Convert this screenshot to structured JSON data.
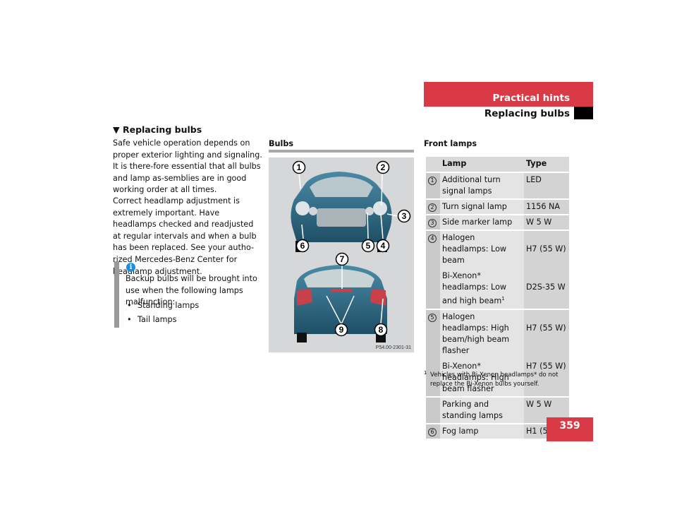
{
  "header": {
    "chapter": "Practical hints",
    "section": "Replacing bulbs",
    "page_number": "359"
  },
  "left": {
    "section_title": "Replacing bulbs",
    "paragraphs": [
      "Safe vehicle operation depends on proper exterior lighting and signaling. It is there-fore essential that all bulbs and lamp as-semblies are in good working order at all times.",
      "Correct headlamp adjustment is extremely important. Have headlamps checked and readjusted at regular intervals and when a bulb has been replaced. See your autho-rized Mercedes-Benz Center for headlamp adjustment."
    ],
    "info": {
      "icon": "info-icon",
      "text": "Backup bulbs will be brought into use when the following lamps malfunction:",
      "items": [
        "Standing lamps",
        "Tail lamps"
      ]
    }
  },
  "middle": {
    "title": "Bulbs",
    "image_code": "P54.00-2301-31",
    "callouts": [
      "1",
      "2",
      "3",
      "4",
      "5",
      "6",
      "7",
      "8",
      "9"
    ]
  },
  "right": {
    "title": "Front lamps",
    "columns": [
      "Lamp",
      "Type"
    ],
    "rows": [
      {
        "num": "1",
        "lamp": [
          "Additional turn signal lamps"
        ],
        "type": [
          "LED"
        ]
      },
      {
        "num": "2",
        "lamp": [
          "Turn signal lamp"
        ],
        "type": [
          "1156 NA"
        ]
      },
      {
        "num": "3",
        "lamp": [
          "Side marker lamp"
        ],
        "type": [
          "W 5 W"
        ]
      },
      {
        "num": "4",
        "lamp": [
          "Halogen headlamps: Low beam",
          "Bi-Xenon* headlamps: Low and high beam"
        ],
        "sup": "1",
        "type": [
          "H7 (55 W)",
          "D2S-35 W"
        ]
      },
      {
        "num": "5",
        "lamp": [
          "Halogen headlamps: High beam/high beam flasher",
          "Bi-Xenon* headlamps: High beam flasher"
        ],
        "type": [
          "H7 (55 W)",
          "H7 (55 W)"
        ]
      },
      {
        "num": "",
        "lamp": [
          "Parking and standing lamps"
        ],
        "type": [
          "W 5 W"
        ]
      },
      {
        "num": "6",
        "lamp": [
          "Fog lamp"
        ],
        "type": [
          "H1 (55 W)"
        ]
      }
    ],
    "footnote": {
      "mark": "1",
      "text": "Vehicles with Bi-Xenon headlamps* do not replace the Bi-Xenon bulbs yourself."
    }
  },
  "colors": {
    "accent": "#d93a45",
    "table_header": "#d9d9d9",
    "info_icon": "#1a8ee0"
  }
}
